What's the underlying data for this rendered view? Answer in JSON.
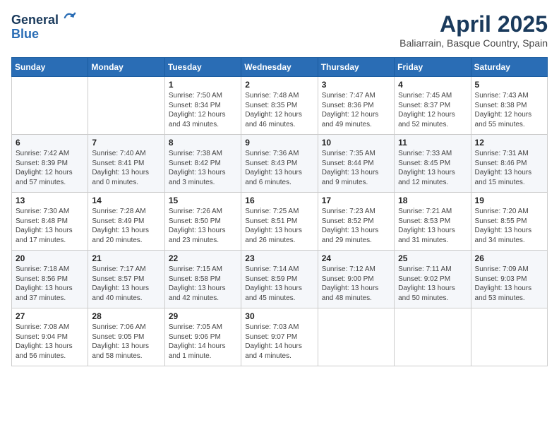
{
  "header": {
    "logo_line1": "General",
    "logo_line2": "Blue",
    "month": "April 2025",
    "location": "Baliarrain, Basque Country, Spain"
  },
  "weekdays": [
    "Sunday",
    "Monday",
    "Tuesday",
    "Wednesday",
    "Thursday",
    "Friday",
    "Saturday"
  ],
  "weeks": [
    [
      {
        "day": "",
        "sunrise": "",
        "sunset": "",
        "daylight": ""
      },
      {
        "day": "",
        "sunrise": "",
        "sunset": "",
        "daylight": ""
      },
      {
        "day": "1",
        "sunrise": "Sunrise: 7:50 AM",
        "sunset": "Sunset: 8:34 PM",
        "daylight": "Daylight: 12 hours and 43 minutes."
      },
      {
        "day": "2",
        "sunrise": "Sunrise: 7:48 AM",
        "sunset": "Sunset: 8:35 PM",
        "daylight": "Daylight: 12 hours and 46 minutes."
      },
      {
        "day": "3",
        "sunrise": "Sunrise: 7:47 AM",
        "sunset": "Sunset: 8:36 PM",
        "daylight": "Daylight: 12 hours and 49 minutes."
      },
      {
        "day": "4",
        "sunrise": "Sunrise: 7:45 AM",
        "sunset": "Sunset: 8:37 PM",
        "daylight": "Daylight: 12 hours and 52 minutes."
      },
      {
        "day": "5",
        "sunrise": "Sunrise: 7:43 AM",
        "sunset": "Sunset: 8:38 PM",
        "daylight": "Daylight: 12 hours and 55 minutes."
      }
    ],
    [
      {
        "day": "6",
        "sunrise": "Sunrise: 7:42 AM",
        "sunset": "Sunset: 8:39 PM",
        "daylight": "Daylight: 12 hours and 57 minutes."
      },
      {
        "day": "7",
        "sunrise": "Sunrise: 7:40 AM",
        "sunset": "Sunset: 8:41 PM",
        "daylight": "Daylight: 13 hours and 0 minutes."
      },
      {
        "day": "8",
        "sunrise": "Sunrise: 7:38 AM",
        "sunset": "Sunset: 8:42 PM",
        "daylight": "Daylight: 13 hours and 3 minutes."
      },
      {
        "day": "9",
        "sunrise": "Sunrise: 7:36 AM",
        "sunset": "Sunset: 8:43 PM",
        "daylight": "Daylight: 13 hours and 6 minutes."
      },
      {
        "day": "10",
        "sunrise": "Sunrise: 7:35 AM",
        "sunset": "Sunset: 8:44 PM",
        "daylight": "Daylight: 13 hours and 9 minutes."
      },
      {
        "day": "11",
        "sunrise": "Sunrise: 7:33 AM",
        "sunset": "Sunset: 8:45 PM",
        "daylight": "Daylight: 13 hours and 12 minutes."
      },
      {
        "day": "12",
        "sunrise": "Sunrise: 7:31 AM",
        "sunset": "Sunset: 8:46 PM",
        "daylight": "Daylight: 13 hours and 15 minutes."
      }
    ],
    [
      {
        "day": "13",
        "sunrise": "Sunrise: 7:30 AM",
        "sunset": "Sunset: 8:48 PM",
        "daylight": "Daylight: 13 hours and 17 minutes."
      },
      {
        "day": "14",
        "sunrise": "Sunrise: 7:28 AM",
        "sunset": "Sunset: 8:49 PM",
        "daylight": "Daylight: 13 hours and 20 minutes."
      },
      {
        "day": "15",
        "sunrise": "Sunrise: 7:26 AM",
        "sunset": "Sunset: 8:50 PM",
        "daylight": "Daylight: 13 hours and 23 minutes."
      },
      {
        "day": "16",
        "sunrise": "Sunrise: 7:25 AM",
        "sunset": "Sunset: 8:51 PM",
        "daylight": "Daylight: 13 hours and 26 minutes."
      },
      {
        "day": "17",
        "sunrise": "Sunrise: 7:23 AM",
        "sunset": "Sunset: 8:52 PM",
        "daylight": "Daylight: 13 hours and 29 minutes."
      },
      {
        "day": "18",
        "sunrise": "Sunrise: 7:21 AM",
        "sunset": "Sunset: 8:53 PM",
        "daylight": "Daylight: 13 hours and 31 minutes."
      },
      {
        "day": "19",
        "sunrise": "Sunrise: 7:20 AM",
        "sunset": "Sunset: 8:55 PM",
        "daylight": "Daylight: 13 hours and 34 minutes."
      }
    ],
    [
      {
        "day": "20",
        "sunrise": "Sunrise: 7:18 AM",
        "sunset": "Sunset: 8:56 PM",
        "daylight": "Daylight: 13 hours and 37 minutes."
      },
      {
        "day": "21",
        "sunrise": "Sunrise: 7:17 AM",
        "sunset": "Sunset: 8:57 PM",
        "daylight": "Daylight: 13 hours and 40 minutes."
      },
      {
        "day": "22",
        "sunrise": "Sunrise: 7:15 AM",
        "sunset": "Sunset: 8:58 PM",
        "daylight": "Daylight: 13 hours and 42 minutes."
      },
      {
        "day": "23",
        "sunrise": "Sunrise: 7:14 AM",
        "sunset": "Sunset: 8:59 PM",
        "daylight": "Daylight: 13 hours and 45 minutes."
      },
      {
        "day": "24",
        "sunrise": "Sunrise: 7:12 AM",
        "sunset": "Sunset: 9:00 PM",
        "daylight": "Daylight: 13 hours and 48 minutes."
      },
      {
        "day": "25",
        "sunrise": "Sunrise: 7:11 AM",
        "sunset": "Sunset: 9:02 PM",
        "daylight": "Daylight: 13 hours and 50 minutes."
      },
      {
        "day": "26",
        "sunrise": "Sunrise: 7:09 AM",
        "sunset": "Sunset: 9:03 PM",
        "daylight": "Daylight: 13 hours and 53 minutes."
      }
    ],
    [
      {
        "day": "27",
        "sunrise": "Sunrise: 7:08 AM",
        "sunset": "Sunset: 9:04 PM",
        "daylight": "Daylight: 13 hours and 56 minutes."
      },
      {
        "day": "28",
        "sunrise": "Sunrise: 7:06 AM",
        "sunset": "Sunset: 9:05 PM",
        "daylight": "Daylight: 13 hours and 58 minutes."
      },
      {
        "day": "29",
        "sunrise": "Sunrise: 7:05 AM",
        "sunset": "Sunset: 9:06 PM",
        "daylight": "Daylight: 14 hours and 1 minute."
      },
      {
        "day": "30",
        "sunrise": "Sunrise: 7:03 AM",
        "sunset": "Sunset: 9:07 PM",
        "daylight": "Daylight: 14 hours and 4 minutes."
      },
      {
        "day": "",
        "sunrise": "",
        "sunset": "",
        "daylight": ""
      },
      {
        "day": "",
        "sunrise": "",
        "sunset": "",
        "daylight": ""
      },
      {
        "day": "",
        "sunrise": "",
        "sunset": "",
        "daylight": ""
      }
    ]
  ]
}
